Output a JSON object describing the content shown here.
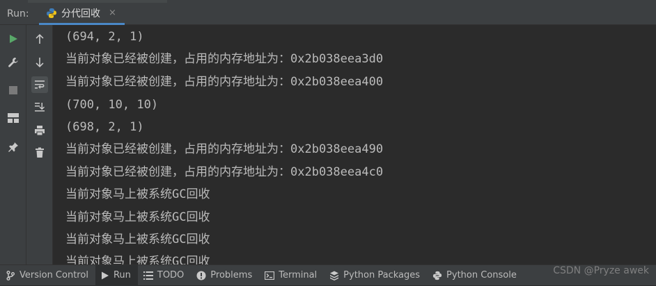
{
  "run_bar": {
    "label": "Run:",
    "tab_name": "分代回收",
    "close_glyph": "×"
  },
  "icons": {
    "left": [
      "run-icon",
      "wrench-icon",
      "stop-icon",
      "layout-icon",
      "pin-icon"
    ],
    "right": [
      "arrow-up-icon",
      "arrow-down-icon",
      "soft-wrap-icon",
      "scroll-to-end-icon",
      "print-icon",
      "trash-icon"
    ]
  },
  "console_lines": [
    "(694, 2, 1)",
    "当前对象已经被创建，占用的内存地址为：0x2b038eea3d0",
    "当前对象已经被创建，占用的内存地址为：0x2b038eea400",
    "(700, 10, 10)",
    "(698, 2, 1)",
    "当前对象已经被创建，占用的内存地址为：0x2b038eea490",
    "当前对象已经被创建，占用的内存地址为：0x2b038eea4c0",
    "当前对象马上被系统GC回收",
    "当前对象马上被系统GC回收",
    "当前对象马上被系统GC回收",
    "当前对象马上被系统GC回收"
  ],
  "bottom_tabs": [
    {
      "label": "Version Control",
      "icon": "branch-icon"
    },
    {
      "label": "Run",
      "icon": "run-icon",
      "selected": true
    },
    {
      "label": "TODO",
      "icon": "list-icon"
    },
    {
      "label": "Problems",
      "icon": "warning-icon"
    },
    {
      "label": "Terminal",
      "icon": "terminal-icon"
    },
    {
      "label": "Python Packages",
      "icon": "packages-icon"
    },
    {
      "label": "Python Console",
      "icon": "python-icon"
    }
  ],
  "watermark": "CSDN @Pryze awek",
  "colors": {
    "background": "#2b2b2b",
    "panel": "#3c3f41",
    "accent": "#4a88c7",
    "run_green": "#59a869"
  }
}
